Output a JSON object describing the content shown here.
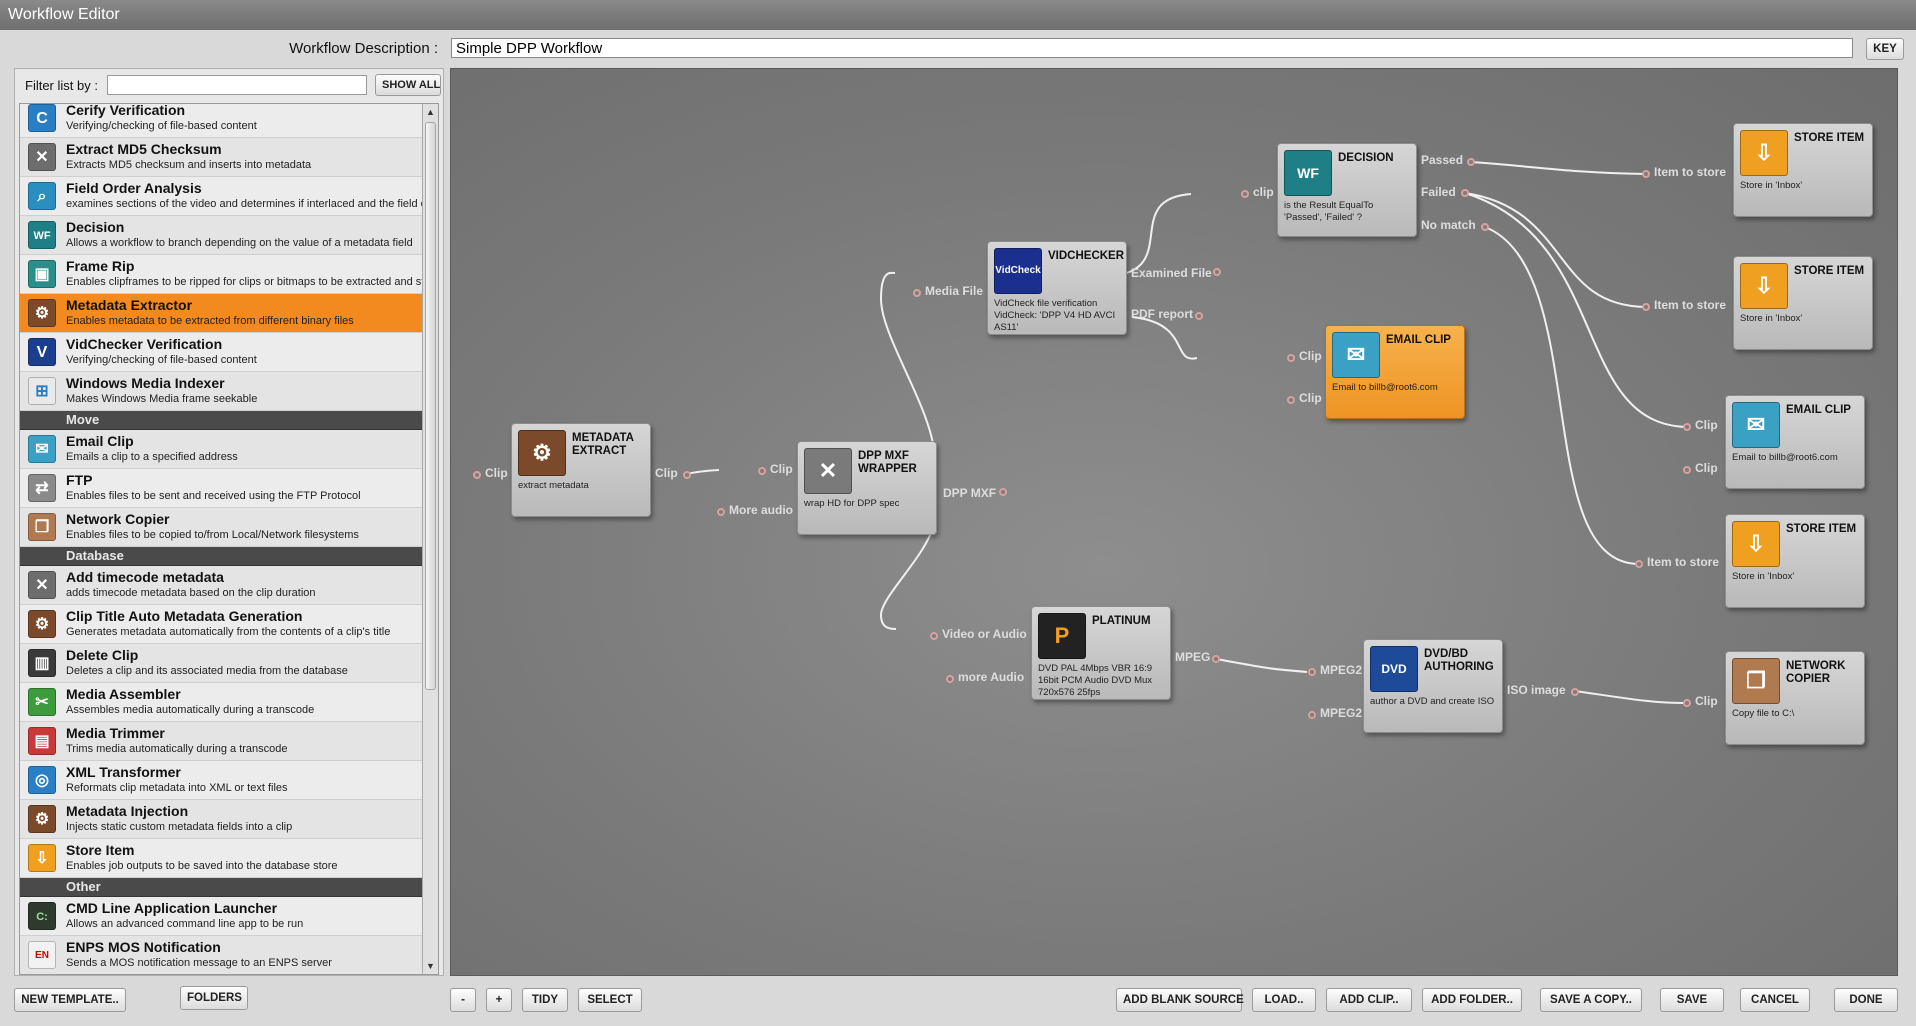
{
  "window": {
    "title": "Workflow Editor"
  },
  "description": {
    "label": "Workflow Description :",
    "value": "Simple DPP Workflow",
    "key_button": "KEY"
  },
  "filter": {
    "label": "Filter list by :",
    "value": "",
    "show_all": "SHOW ALL"
  },
  "list": {
    "items_top": [
      {
        "name": "Cerify Verification",
        "desc": "Verifying/checking of file-based content",
        "icon": "cerify-icon",
        "color": "#2a7fc4",
        "glyph": "C"
      },
      {
        "name": "Extract MD5 Checksum",
        "desc": "Extracts MD5 checksum and inserts into metadata",
        "icon": "tools-icon",
        "color": "#6d6d6d",
        "glyph": "✕"
      },
      {
        "name": "Field Order Analysis",
        "desc": "examines sections of the video and determines if interlaced and the field or",
        "icon": "magnifier-icon",
        "color": "#2a8fc0",
        "glyph": "⌕"
      },
      {
        "name": "Decision",
        "desc": "Allows a workflow to branch depending on the value of a metadata field",
        "icon": "decision-icon",
        "color": "#1f7f86",
        "glyph": "WF"
      },
      {
        "name": "Frame Rip",
        "desc": "Enables clipframes to be ripped for clips or bitmaps to be extracted and sto",
        "icon": "camera-icon",
        "color": "#2a8f8a",
        "glyph": "▣"
      },
      {
        "name": "Metadata Extractor",
        "desc": "Enables metadata to be extracted from different binary files",
        "icon": "metadata-icon",
        "color": "#7a4a2a",
        "glyph": "⚙"
      },
      {
        "name": "VidChecker Verification",
        "desc": "Verifying/checking of file-based content",
        "icon": "vidchecker-icon",
        "color": "#1b3f8e",
        "glyph": "V"
      },
      {
        "name": "Windows Media Indexer",
        "desc": "Makes Windows Media frame seekable",
        "icon": "windows-icon",
        "color": "#e9e9e9",
        "glyph": "⊞"
      }
    ],
    "section_move": "Move",
    "items_move": [
      {
        "name": "Email Clip",
        "desc": "Emails a clip to a specified address",
        "icon": "envelope-icon",
        "color": "#3aa0c4",
        "glyph": "✉"
      },
      {
        "name": "FTP",
        "desc": "Enables files to be sent and received using the FTP Protocol",
        "icon": "ftp-icon",
        "color": "#8a8a8a",
        "glyph": "⇄"
      },
      {
        "name": "Network Copier",
        "desc": "Enables files to be copied to/from Local/Network filesystems",
        "icon": "copy-icon",
        "color": "#b07a50",
        "glyph": "❐"
      }
    ],
    "section_database": "Database",
    "items_database": [
      {
        "name": "Add timecode metadata",
        "desc": "adds timecode metadata based on the clip duration",
        "icon": "tools-icon",
        "color": "#6d6d6d",
        "glyph": "✕"
      },
      {
        "name": "Clip Title Auto Metadata Generation",
        "desc": "Generates metadata automatically from the contents of a clip's title",
        "icon": "metadata-icon",
        "color": "#7a4a2a",
        "glyph": "⚙"
      },
      {
        "name": "Delete Clip",
        "desc": "Deletes a clip and its associated media from the database",
        "icon": "trash-icon",
        "color": "#3a3a3a",
        "glyph": "🗑"
      },
      {
        "name": "Media Assembler",
        "desc": "Assembles media automatically during a transcode",
        "icon": "scissors-icon",
        "color": "#3d9a3d",
        "glyph": "✂"
      },
      {
        "name": "Media Trimmer",
        "desc": "Trims media automatically during a transcode",
        "icon": "trimmer-icon",
        "color": "#c83a3a",
        "glyph": "▤"
      },
      {
        "name": "XML Transformer",
        "desc": "Reformats clip metadata into XML or text files",
        "icon": "xml-icon",
        "color": "#2a7fc4",
        "glyph": "◎"
      },
      {
        "name": "Metadata Injection",
        "desc": "Injects static custom metadata fields into a clip",
        "icon": "metadata-icon",
        "color": "#7a4a2a",
        "glyph": "⚙"
      },
      {
        "name": "Store Item",
        "desc": "Enables job outputs to be saved into the database store",
        "icon": "store-icon",
        "color": "#f0a020",
        "glyph": "⇩"
      }
    ],
    "section_other": "Other",
    "items_other": [
      {
        "name": "CMD Line Application Launcher",
        "desc": "Allows an advanced command line app to be run",
        "icon": "cmd-icon",
        "color": "#2d3a2d",
        "glyph": "C:"
      },
      {
        "name": "ENPS MOS Notification",
        "desc": "Sends a MOS notification message to an ENPS server",
        "icon": "enps-icon",
        "color": "#f2f2f2",
        "glyph": "EN"
      }
    ]
  },
  "nodes": {
    "metadata_extract": {
      "title": "METADATA EXTRACT",
      "desc": "extract metadata",
      "in_clip": "Clip",
      "out_clip": "Clip"
    },
    "dpp_mxf": {
      "title": "DPP MXF WRAPPER",
      "desc": "wrap HD for DPP spec",
      "in_clip": "Clip",
      "in_more_audio": "More audio",
      "out": "DPP MXF"
    },
    "vidchecker": {
      "title": "VIDCHECKER",
      "icon_text": "VidCheck",
      "desc": "VidCheck file verification VidCheck: 'DPP V4 HD AVCI AS11'",
      "in": "Media File",
      "out_examined": "Examined File",
      "out_pdf": "PDF report"
    },
    "platinum": {
      "title": "PLATINUM",
      "desc": "DVD PAL 4Mbps VBR 16:9 16bit PCM Audio DVD Mux 720x576 25fps",
      "in_video": "Video or Audio",
      "in_more": "more Audio",
      "out": "MPEG"
    },
    "decision": {
      "title": "DECISION",
      "desc": "is the Result EqualTo 'Passed', 'Failed' ?",
      "in": "clip",
      "out_passed": "Passed",
      "out_failed": "Failed",
      "out_nomatch": "No match"
    },
    "email_clip_1": {
      "title": "EMAIL CLIP",
      "desc": "Email to billb@root6.com",
      "in1": "Clip",
      "in2": "Clip"
    },
    "dvd_bd": {
      "title": "DVD/BD AUTHORING",
      "desc": "author a DVD and create ISO",
      "in1": "MPEG2",
      "in2": "MPEG2",
      "out": "ISO image"
    },
    "store_1": {
      "title": "STORE ITEM",
      "desc": "Store in 'Inbox'",
      "in": "Item to store"
    },
    "store_2": {
      "title": "STORE ITEM",
      "desc": "Store in 'Inbox'",
      "in": "Item to store"
    },
    "email_clip_2": {
      "title": "EMAIL CLIP",
      "desc": "Email to billb@root6.com",
      "in1": "Clip",
      "in2": "Clip"
    },
    "store_3": {
      "title": "STORE ITEM",
      "desc": "Store in 'Inbox'",
      "in": "Item to store"
    },
    "network_copier": {
      "title": "NETWORK COPIER",
      "desc": "Copy file to C:\\",
      "in": "Clip"
    }
  },
  "bottom": {
    "new_template": "NEW TEMPLATE..",
    "folders": "FOLDERS",
    "zoom_out": "-",
    "zoom_in": "+",
    "tidy": "TIDY",
    "select": "SELECT",
    "add_blank_source": "ADD BLANK SOURCE",
    "load": "LOAD..",
    "add_clip": "ADD CLIP..",
    "add_folder": "ADD FOLDER..",
    "save_copy": "SAVE A COPY..",
    "save": "SAVE",
    "cancel": "CANCEL",
    "done": "DONE"
  },
  "colors": {
    "selected_row": "#f28a20",
    "section_bg": "#4a4a4a",
    "canvas_bg": "#7d7d7d",
    "wire": "#f0f0f0"
  }
}
